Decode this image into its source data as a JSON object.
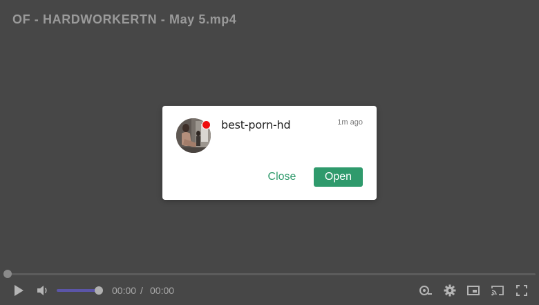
{
  "video": {
    "title": "OF - HARDWORKERTN - May 5.mp4"
  },
  "notification": {
    "sender": "best-porn-hd",
    "timestamp": "1m ago",
    "close_label": "Close",
    "open_label": "Open",
    "online": true
  },
  "controls": {
    "progress": 0,
    "volume": 1,
    "current_time": "00:00",
    "separator": "/",
    "duration": "00:00",
    "icons": [
      "play-icon",
      "volume-icon",
      "speed-icon",
      "settings-icon",
      "picture-in-picture-icon",
      "cast-icon",
      "fullscreen-icon"
    ]
  },
  "colors": {
    "background": "#474747",
    "accent": "#2f9a6c",
    "online_dot": "#ee0d0d",
    "volume_fill": "#5b55a8"
  }
}
